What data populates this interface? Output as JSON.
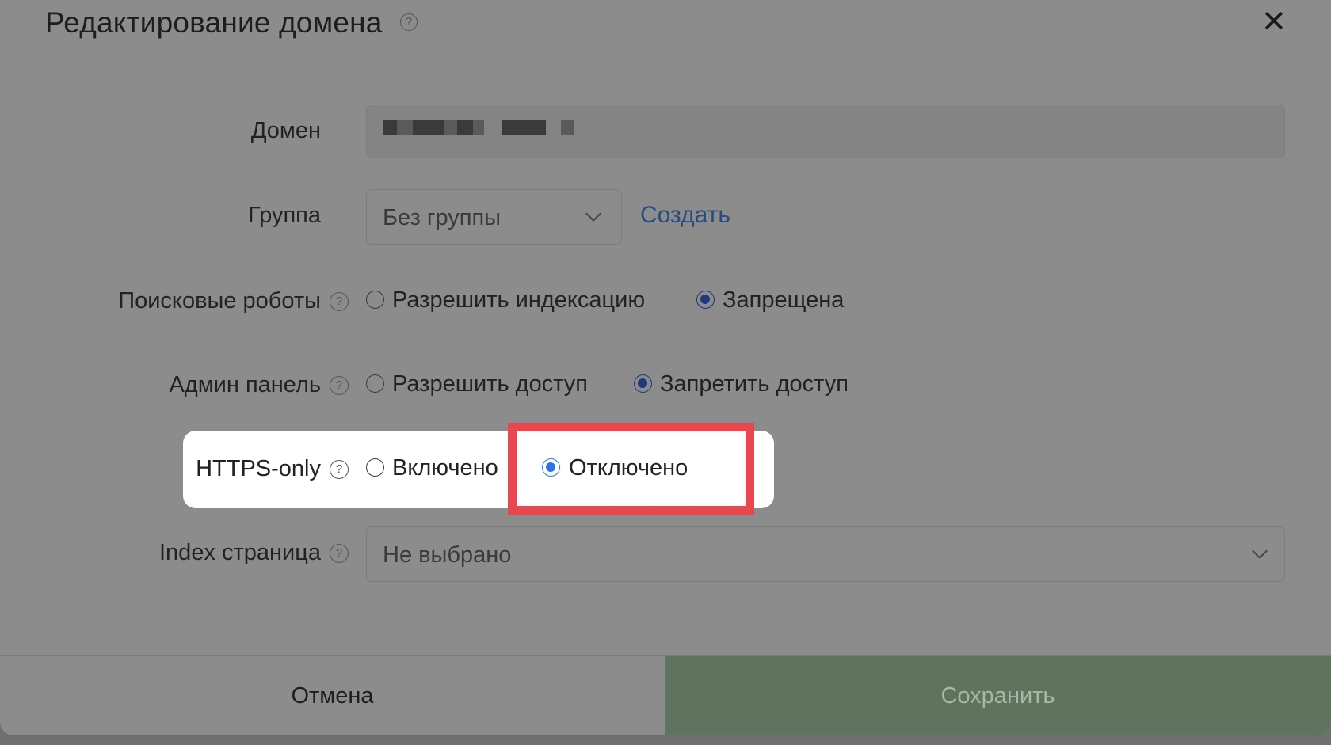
{
  "dialog": {
    "title": "Редактирование домена",
    "close_glyph": "✕"
  },
  "help_glyph": "?",
  "domain": {
    "label": "Домен"
  },
  "group": {
    "label": "Группа",
    "selected": "Без группы",
    "create_link": "Создать"
  },
  "robots": {
    "label": "Поисковые роботы",
    "options": [
      "Разрешить индексацию",
      "Запрещена"
    ],
    "selected_index": 1
  },
  "admin": {
    "label": "Админ панель",
    "options": [
      "Разрешить доступ",
      "Запретить доступ"
    ],
    "selected_index": 1
  },
  "https": {
    "label": "HTTPS-only",
    "options": [
      "Включено",
      "Отключено"
    ],
    "selected_index": 1
  },
  "index_page": {
    "label": "Index страница",
    "selected": "Не выбрано"
  },
  "footer": {
    "cancel_label": "Отмена",
    "save_label": "Сохранить"
  },
  "colors": {
    "overlay": "#8c8c8c",
    "highlight_border": "#e8474f",
    "radio_accent": "#2d73e6",
    "save_button": "#5f735e",
    "link": "#274d80"
  },
  "icons": {
    "help": "question-circle-icon",
    "close": "close-icon",
    "dropdown": "chevron-down-icon"
  }
}
